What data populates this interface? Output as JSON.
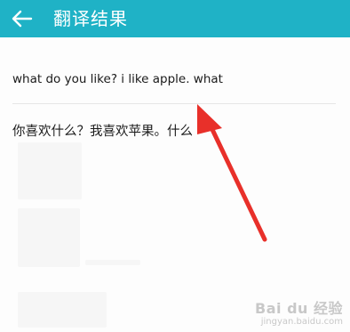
{
  "header": {
    "title": "翻译结果",
    "back_icon": "arrow-left-icon",
    "bg_color": "#1fb2c6"
  },
  "source": {
    "text": "what do you like? i like apple. what"
  },
  "translation": {
    "text": "你喜欢什么？我喜欢苹果。什么"
  },
  "annotation": {
    "arrow_color": "#e8302a"
  },
  "watermark": {
    "logo": "Bai du 经验",
    "url": "jingyan.baidu.com"
  }
}
